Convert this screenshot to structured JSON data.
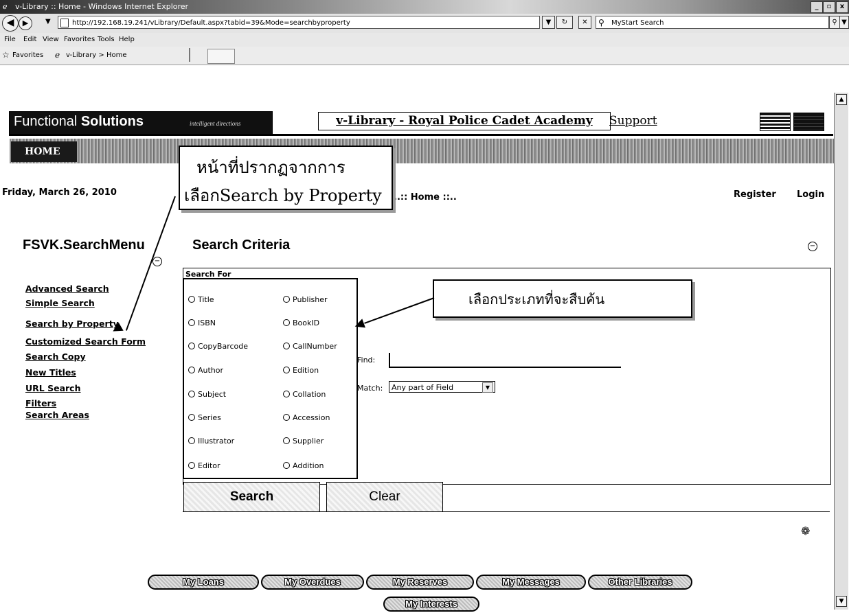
{
  "browser": {
    "window_title": "v-Library :: Home - Windows Internet Explorer",
    "address_url": "http://192.168.19.241/vLibrary/Default.aspx?tabid=39&Mode=searchbyproperty",
    "search_placeholder": "MyStart Search",
    "menu": [
      "File",
      "Edit",
      "View",
      "Favorites",
      "Tools",
      "Help"
    ],
    "favorites_label": "Favorites",
    "favorites_tab": "v-Library > Home",
    "window_buttons": [
      "_",
      "▫",
      "x"
    ]
  },
  "header": {
    "brand_plain": "Functional ",
    "brand_bold": "Solutions",
    "brand_tagline": "intelligent directions",
    "site_title": "v-Library - Royal Police Cadet Academy",
    "support_label": "Support",
    "home_tab": "HOME"
  },
  "status": {
    "date": "Friday, March 26, 2010",
    "breadcrumb": "..:: Home ::..",
    "register": "Register",
    "login": "Login"
  },
  "annotations": {
    "left_line1": "หน้าที่ปรากฏจากการ",
    "left_line2": "เลือกSearch by Property",
    "right_line1": "เลือกประเภทที่จะสืบค้น"
  },
  "search_menu": {
    "title": "FSVK.SearchMenu",
    "items": [
      "Advanced Search",
      "Simple Search",
      "Search by Property",
      "Customized Search Form",
      "Search Copy",
      "New Titles",
      "URL Search",
      "Filters",
      "Search Areas"
    ]
  },
  "search": {
    "title": "Search Criteria",
    "search_for_label": "Search For",
    "properties_left": [
      "Title",
      "ISBN",
      "CopyBarcode",
      "Author",
      "Subject",
      "Series",
      "Illustrator",
      "Editor"
    ],
    "properties_right": [
      "Publisher",
      "BookID",
      "CallNumber",
      "Edition",
      "Collation",
      "Accession",
      "Supplier",
      "Addition"
    ],
    "find_label": "Find:",
    "find_value": "",
    "match_label": "Match:",
    "match_value": "Any part of Field",
    "search_button": "Search",
    "clear_button": "Clear"
  },
  "footer_buttons": [
    "My Loans",
    "My Overdues",
    "My Reserves",
    "My Messages",
    "Other Libraries",
    "My Interests"
  ]
}
